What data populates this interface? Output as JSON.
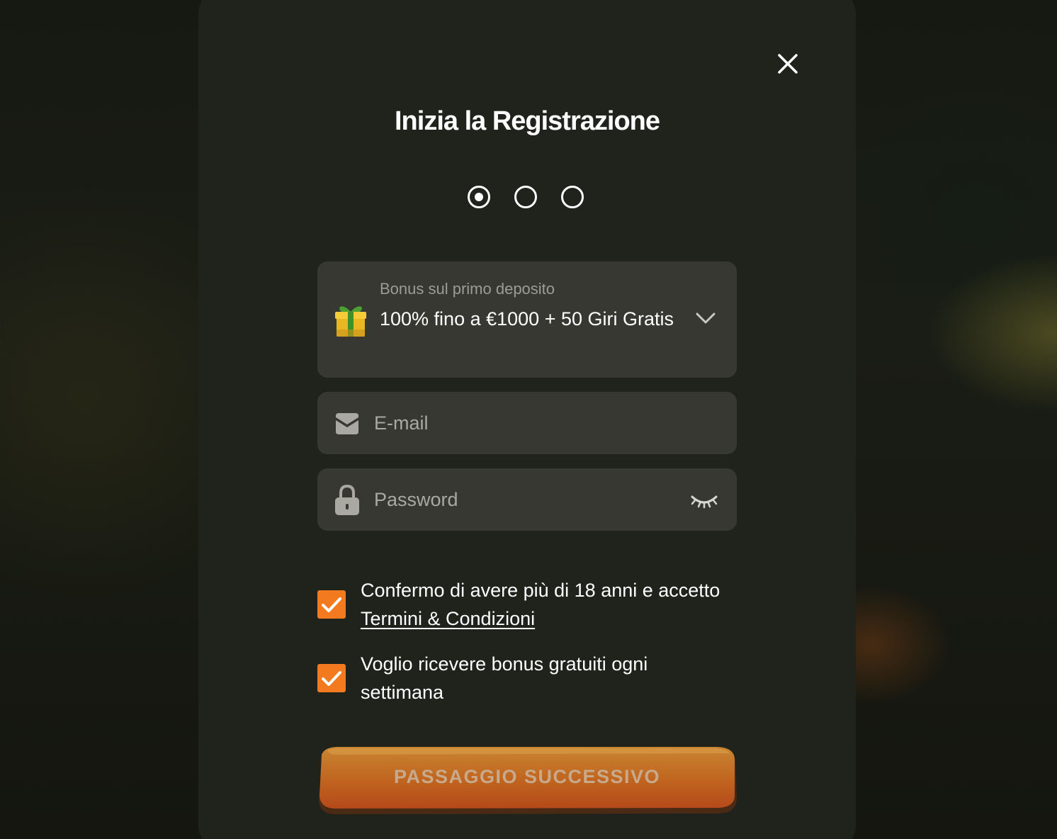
{
  "modal": {
    "title": "Inizia la Registrazione",
    "steps": {
      "current": 1,
      "total": 3
    }
  },
  "bonus_select": {
    "label": "Bonus sul primo deposito",
    "value": "100% fino a €1000 + 50 Giri Gratis",
    "icon": "gift-icon"
  },
  "email_field": {
    "placeholder": "E-mail",
    "value": "",
    "icon": "envelope-icon"
  },
  "password_field": {
    "placeholder": "Password",
    "value": "",
    "icon": "lock-icon",
    "toggle_icon": "eye-closed-icon"
  },
  "consents": [
    {
      "text_before": "Confermo di avere più di 18 anni e accetto ",
      "link_text": "Termini & Condizioni",
      "checked": true
    },
    {
      "text": "Voglio ricevere bonus gratuiti ogni settimana",
      "checked": true
    }
  ],
  "next_button": {
    "label": "PASSAGGIO SUCCESSIVO"
  },
  "colors": {
    "accent": "#f47a1f",
    "modal_bg": "#20221c",
    "field_bg": "#383833",
    "button_gradient_top": "#c98532",
    "button_gradient_bottom": "#b5491a"
  }
}
